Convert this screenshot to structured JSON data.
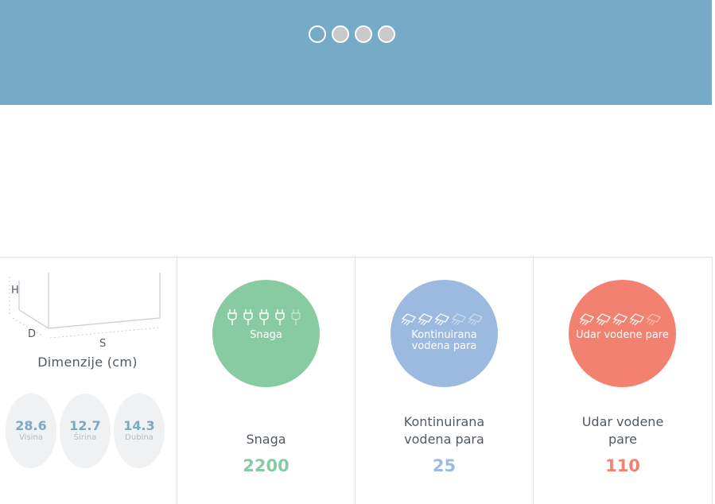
{
  "carousel": {
    "dots": [
      {
        "active": true
      },
      {
        "active": false
      },
      {
        "active": false
      },
      {
        "active": false
      }
    ]
  },
  "dimensions": {
    "title": "Dimenzije (cm)",
    "diagram_labels": {
      "h": "H",
      "d": "D",
      "s": "S"
    },
    "values": [
      {
        "value": "28.6",
        "label": "Visina"
      },
      {
        "value": "12.7",
        "label": "Širina"
      },
      {
        "value": "14.3",
        "label": "Dubina"
      }
    ]
  },
  "specs": [
    {
      "circle_label": "Snaga",
      "label": "Snaga",
      "value": "2200",
      "color": "#88cba2",
      "icon": "plug-icon",
      "rating": 4,
      "max": 5
    },
    {
      "circle_label": "Kontinuirana vodena para",
      "label": "Kontinuirana vodena para",
      "value": "25",
      "color": "#9cbadf",
      "icon": "steam-icon",
      "rating": 3,
      "max": 5
    },
    {
      "circle_label": "Udar vodene pare",
      "label": "Udar vodene pare",
      "value": "110",
      "color": "#f38170",
      "icon": "steam-icon",
      "rating": 4,
      "max": 5
    }
  ]
}
